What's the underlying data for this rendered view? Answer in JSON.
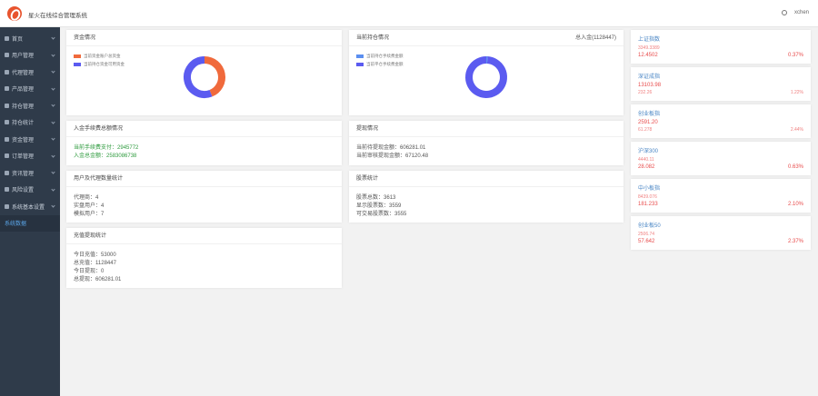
{
  "app": {
    "title": "星火在线综合管理系统",
    "user": "xchen"
  },
  "sidebar": {
    "items": [
      {
        "label": "首页"
      },
      {
        "label": "用户管理"
      },
      {
        "label": "代理管理"
      },
      {
        "label": "产品管理"
      },
      {
        "label": "持仓管理"
      },
      {
        "label": "持仓统计"
      },
      {
        "label": "资金管理"
      },
      {
        "label": "订单管理"
      },
      {
        "label": "资讯管理"
      },
      {
        "label": "风险设置"
      },
      {
        "label": "系统基本设置"
      },
      {
        "label": "系统数据"
      }
    ]
  },
  "cards": {
    "funds": {
      "title": "资金情况",
      "legend": [
        "当前资金账户总资金",
        "当前持仓资金可用资金"
      ],
      "colors": [
        "#f06a3c",
        "#5b5bf0"
      ],
      "chart_data": {
        "type": "pie",
        "values": [
          0.44,
          0.56
        ]
      }
    },
    "positions": {
      "title": "当前持仓情况",
      "extra": "总入金(1128447)",
      "legend": [
        "当前持仓手续费金额",
        "当前平仓手续费金额"
      ],
      "colors": [
        "#5b8ff0",
        "#5b5bf0"
      ],
      "chart_data": {
        "type": "pie",
        "values": [
          0.01,
          0.99
        ]
      }
    },
    "deposit": {
      "title": "入金手续费总额情况",
      "l1": "当前手续费支付：",
      "v1": "2945772",
      "l2": "入金总金额：",
      "v2": "2583086738"
    },
    "withdraw": {
      "title": "提现情况",
      "l1": "当前待提现金额：",
      "v1": "606281.01",
      "l2": "当前审核提现金额：",
      "v2": "67120.48"
    },
    "agents": {
      "title": "用户及代理数量统计",
      "l1": "代理商：",
      "v1": "4",
      "l2": "实盘用户：",
      "v2": "4",
      "l3": "模拟用户：",
      "v3": "7"
    },
    "stock": {
      "title": "股票统计",
      "l1": "股票总数：",
      "v1": "3613",
      "l2": "显示股票数：",
      "v2": "3559",
      "l3": "可交易股票数：",
      "v3": "3555"
    },
    "recharge": {
      "title": "充值提现统计",
      "l1": "今日充值：",
      "v1": "53000",
      "l2": "总充值：",
      "v2": "1128447",
      "l3": "今日提现：",
      "v3": "0",
      "l4": "总提现：",
      "v4": "606281.01"
    }
  },
  "indices": [
    {
      "name": "上证指数",
      "v1": "3349.3389",
      "v2": "12.4502",
      "pct": "0.37%"
    },
    {
      "name": "深证成指",
      "v1": "13103.98",
      "v2": "232.26",
      "pct": "1.22%"
    },
    {
      "name": "创业板指",
      "v1": "2591.20",
      "v2": "61.278",
      "pct": "2.44%"
    },
    {
      "name": "沪深300",
      "v1": "4440.11",
      "v2": "28.082",
      "pct": "0.63%"
    },
    {
      "name": "中小板指",
      "v1": "8439.076",
      "v2": "181.233",
      "pct": "2.10%"
    },
    {
      "name": "创业板50",
      "v1": "2506.74",
      "v2": "57.642",
      "pct": "2.37%"
    }
  ]
}
